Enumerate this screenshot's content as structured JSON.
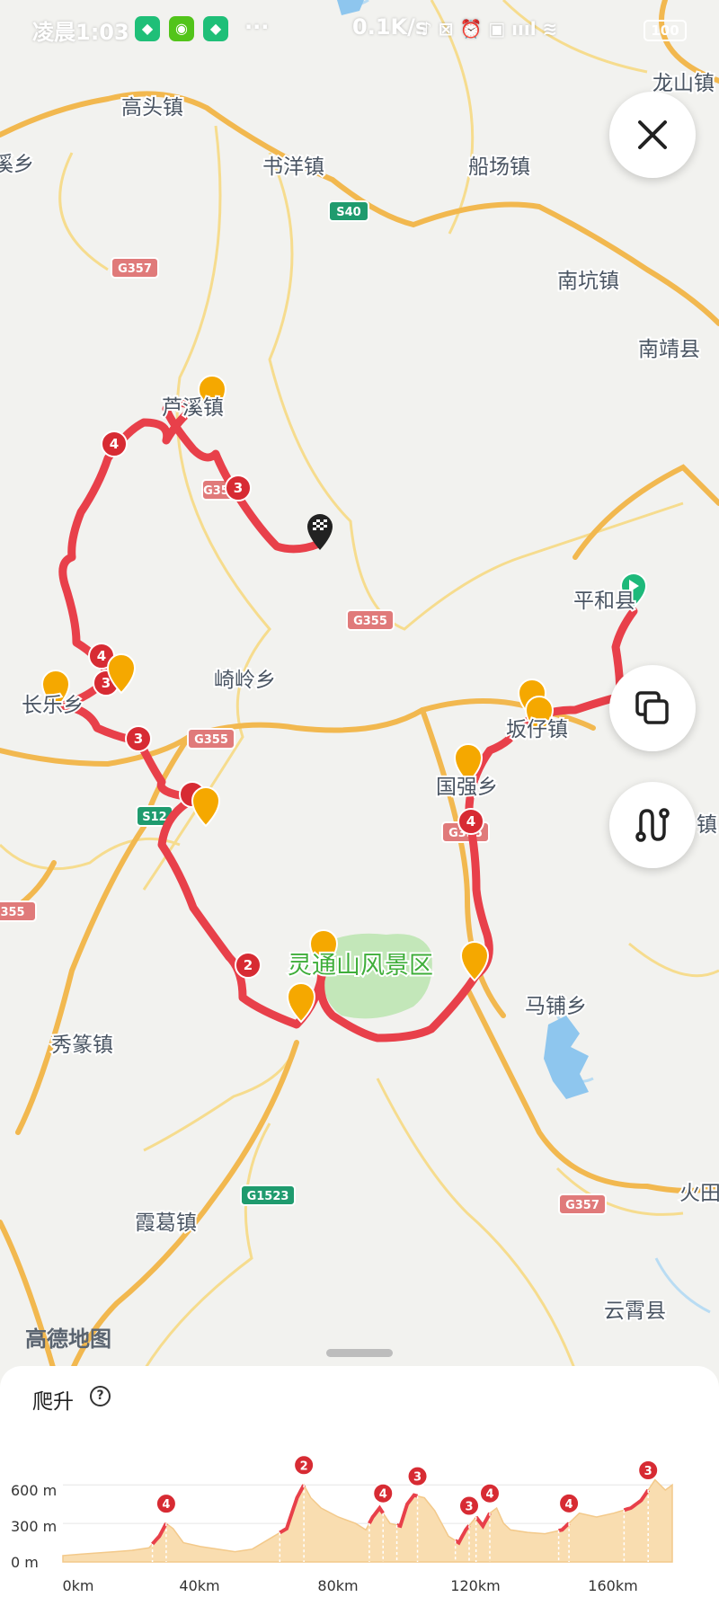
{
  "status_bar": {
    "time": "凌晨1:03",
    "speed": "0.1K/s",
    "battery": "100"
  },
  "map": {
    "places": [
      {
        "name": "高头镇"
      },
      {
        "name": "书洋镇"
      },
      {
        "name": "船场镇"
      },
      {
        "name": "南坑镇"
      },
      {
        "name": "南靖县"
      },
      {
        "name": "龙山镇"
      },
      {
        "name": "溪乡"
      },
      {
        "name": "芦溪镇"
      },
      {
        "name": "崎岭乡"
      },
      {
        "name": "长乐乡"
      },
      {
        "name": "平和县"
      },
      {
        "name": "坂仔镇"
      },
      {
        "name": "国强乡"
      },
      {
        "name": "马铺乡"
      },
      {
        "name": "秀篆镇"
      },
      {
        "name": "霞葛镇"
      },
      {
        "name": "云霄县"
      },
      {
        "name": "火田"
      },
      {
        "name": "镇"
      },
      {
        "name": "大平镇"
      }
    ],
    "scenic_area": "灵通山风景区",
    "roads": [
      "S40",
      "G357",
      "G355",
      "G355",
      "G355",
      "S12",
      "G355",
      "G357",
      "G1523",
      "G357",
      "355"
    ],
    "climb_markers": [
      "4",
      "3",
      "4",
      "3",
      "3",
      "2",
      "4"
    ],
    "watermark": "高德地图",
    "colors": {
      "route": "#e8404a",
      "road": "#f2b84f",
      "highway": "#e07a7a",
      "marker": "#f5a800",
      "start": "#1db97a"
    }
  },
  "buttons": {
    "close_icon": "close-icon",
    "layers_icon": "layers-icon",
    "route_icon": "route-icon"
  },
  "elevation": {
    "title": "爬升",
    "help_icon": "help-circle-icon",
    "y_labels": [
      "600 m",
      "300 m",
      "0 m"
    ],
    "x_labels": [
      "0km",
      "40km",
      "80km",
      "120km",
      "160km"
    ]
  },
  "chart_data": {
    "type": "area",
    "xlabel": "",
    "ylabel": "",
    "xlim": [
      0,
      177
    ],
    "ylim": [
      0,
      700
    ],
    "x": [
      0,
      5,
      10,
      15,
      20,
      25,
      28,
      30,
      32,
      35,
      40,
      45,
      50,
      55,
      60,
      65,
      68,
      70,
      72,
      75,
      80,
      85,
      88,
      90,
      92,
      95,
      98,
      100,
      102,
      105,
      108,
      110,
      112,
      115,
      117,
      120,
      122,
      124,
      126,
      128,
      130,
      135,
      140,
      145,
      150,
      155,
      160,
      165,
      168,
      170,
      172,
      175,
      177
    ],
    "values": [
      50,
      60,
      70,
      80,
      90,
      110,
      200,
      300,
      260,
      150,
      120,
      100,
      80,
      100,
      180,
      260,
      500,
      600,
      500,
      420,
      350,
      300,
      250,
      350,
      420,
      300,
      280,
      450,
      520,
      500,
      400,
      300,
      200,
      150,
      250,
      350,
      280,
      380,
      420,
      300,
      250,
      230,
      220,
      250,
      380,
      350,
      380,
      420,
      480,
      560,
      640,
      560,
      600
    ],
    "climbs": [
      {
        "label": "4",
        "x0": 26,
        "x1": 30
      },
      {
        "label": "2",
        "x0": 63,
        "x1": 70
      },
      {
        "label": "4",
        "x0": 89,
        "x1": 93
      },
      {
        "label": "3",
        "x0": 97,
        "x1": 103
      },
      {
        "label": "3",
        "x0": 114,
        "x1": 118
      },
      {
        "label": "4",
        "x0": 120,
        "x1": 124
      },
      {
        "label": "4",
        "x0": 144,
        "x1": 147
      },
      {
        "label": "3",
        "x0": 163,
        "x1": 170
      }
    ]
  }
}
